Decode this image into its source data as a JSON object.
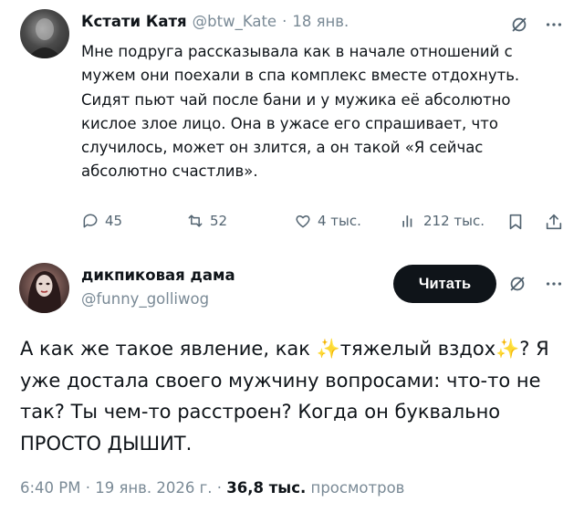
{
  "tweet1": {
    "author_name": "Кстати Катя",
    "author_handle": "@btw_Kate",
    "separator": "·",
    "date": "18 янв.",
    "text_lines": [
      "Мне подруга рассказывала как в начале отношений с",
      "мужем они поехали в спа комплекс вместе отдохнуть.",
      "Сидят пьют чай после бани и у мужика её абсолютно",
      "кислое злое лицо. Она в ужасе его спрашивает, что",
      "случилось, может он злится, а он такой «Я сейчас",
      "абсолютно счастлив»."
    ],
    "actions": {
      "replies": "45",
      "retweets": "52",
      "likes": "4 тыс.",
      "views": "212 тыс."
    }
  },
  "tweet2": {
    "author_name": "дикпиковая дама",
    "author_handle": "@funny_golliwog",
    "follow_label": "Читать",
    "text": {
      "line1_a": "А как же такое явление, как ",
      "line1_b": "тяжелый вздох",
      "line1_c": "? Я",
      "line2": "уже достала своего мужчину вопросами: что-то не",
      "line3": "так? Ты чем-то расстроен? Когда он буквально",
      "line4": "ПРОСТО ДЫШИТ."
    },
    "sparkle_glyph": "✨",
    "meta": {
      "time_date": "6:40 PM · 19 янв. 2026 г. · ",
      "views_count": "36,8 тыс.",
      "views_label": " просмотров"
    }
  },
  "icons": {
    "grok": "grok-icon",
    "more": "more-icon",
    "reply": "reply-icon",
    "retweet": "retweet-icon",
    "like": "like-icon",
    "views": "views-icon",
    "bookmark": "bookmark-icon",
    "share": "share-icon"
  },
  "colors": {
    "text": "#0f1419",
    "muted": "#536471",
    "button_bg": "#0f1419",
    "sparkle": "#f6c21c"
  }
}
